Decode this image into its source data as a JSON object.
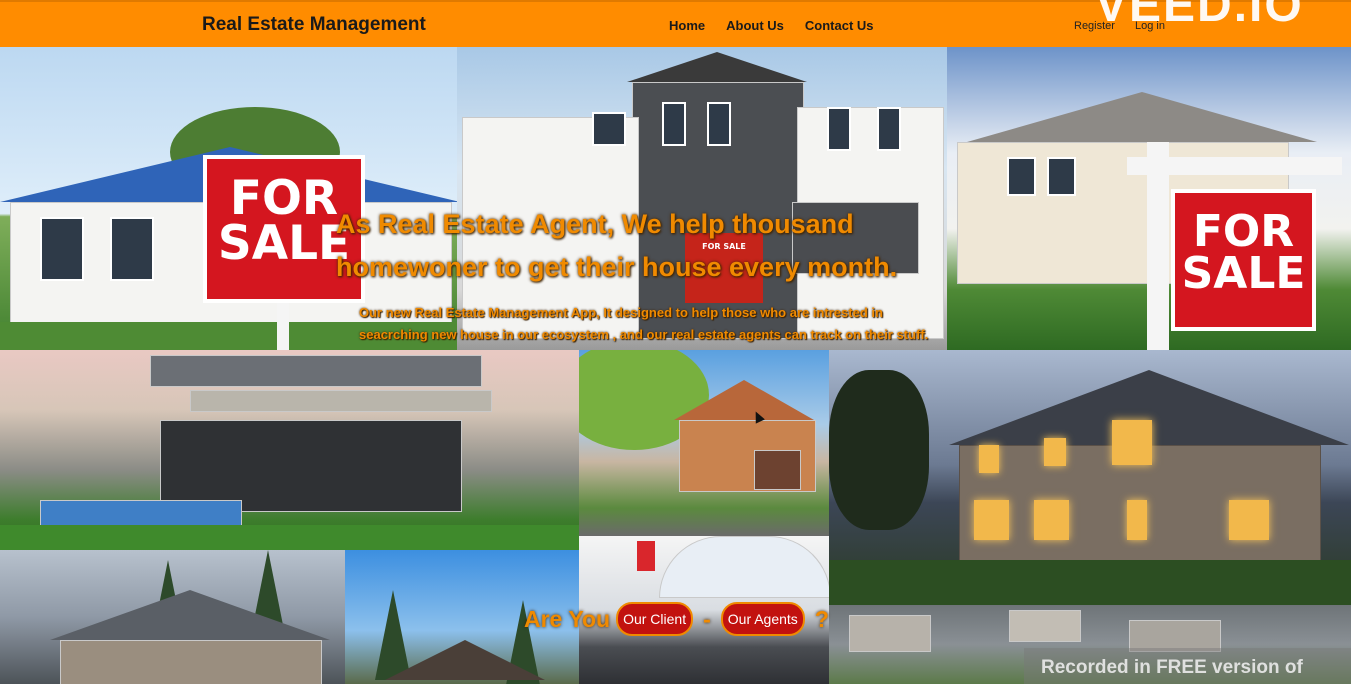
{
  "header": {
    "brand": "Real Estate Management",
    "nav": [
      "Home",
      "About Us",
      "Contact Us"
    ],
    "auth": {
      "register": "Register",
      "login": "Log in"
    },
    "colors": {
      "bar": "#ff8c00",
      "text": "#1a1a1a"
    }
  },
  "watermark_top": "VEED.IO",
  "hero": {
    "title_line1": "As Real Estate Agent, We help thousand",
    "title_line2": "homewoner to get their house every month.",
    "subtitle_line1": "Our new Real Estate Management App, It designed to help those who are intrested in",
    "subtitle_line2": "seacrching new house in our ecosystem , and our real estate agents can track on their stuff.",
    "accent_color": "#f08a00"
  },
  "signs": {
    "left_line1": "FOR",
    "left_line2": "SALE",
    "center": "FOR SALE",
    "right_line1": "FOR",
    "right_line2": "SALE"
  },
  "cta": {
    "prefix": "Are You",
    "client_button": "Our Client",
    "separator": "-",
    "agents_button": "Our Agents",
    "suffix": "?",
    "button_color": "#c2120f"
  },
  "watermark_bottom": "Recorded in FREE version of"
}
